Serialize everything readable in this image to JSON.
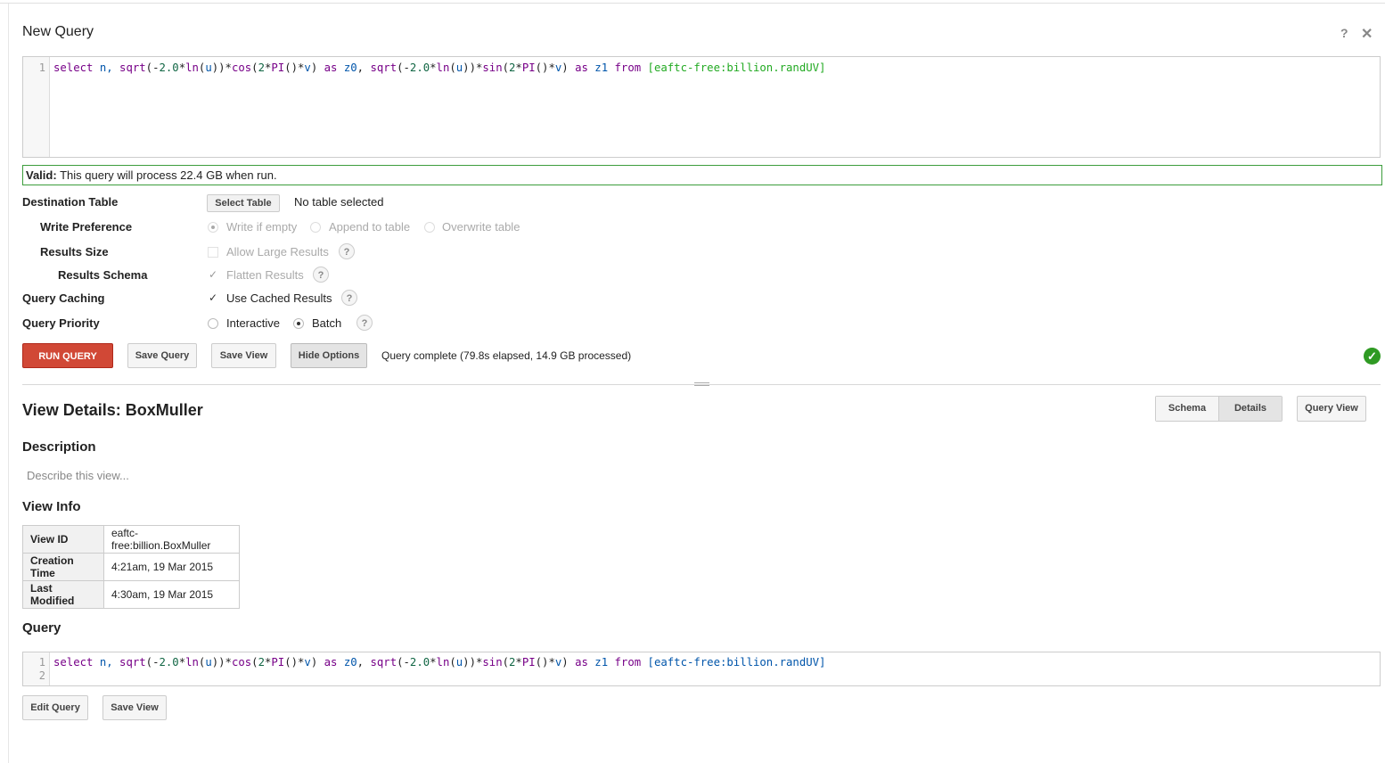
{
  "header": {
    "title": "New Query",
    "help_icon": "?",
    "close_icon": "✕"
  },
  "editor": {
    "line_numbers": [
      "1"
    ],
    "query_parts": {
      "t1": "select",
      "t2": " n, ",
      "t3": "sqrt",
      "t4": "(-",
      "t5": "2.0",
      "t6": "*",
      "t7": "ln",
      "t8": "(",
      "t9": "u",
      "t10": "))*",
      "t11": "cos",
      "t12": "(",
      "t13": "2",
      "t14": "*",
      "t15": "PI",
      "t16": "()*",
      "t17": "v",
      "t18": ") ",
      "t19": "as",
      "t20": " ",
      "t21": "z0",
      "t22": ", ",
      "t23": "sqrt",
      "t24": "(-",
      "t25": "2.0",
      "t26": "*",
      "t27": "ln",
      "t28": "(",
      "t29": "u",
      "t30": "))*",
      "t31": "sin",
      "t32": "(",
      "t33": "2",
      "t34": "*",
      "t35": "PI",
      "t36": "()*",
      "t37": "v",
      "t38": ") ",
      "t39": "as",
      "t40": " ",
      "t41": "z1",
      "t42": " ",
      "t43": "from",
      "t44": " ",
      "t45": "[eaftc-free:billion.randUV]"
    }
  },
  "validation": {
    "prefix": "Valid:",
    "message": "This query will process 22.4 GB when run."
  },
  "options": {
    "destination_table": {
      "label": "Destination Table",
      "button": "Select Table",
      "value": "No table selected"
    },
    "write_preference": {
      "label": "Write Preference",
      "options": [
        "Write if empty",
        "Append to table",
        "Overwrite table"
      ],
      "selected": "Write if empty"
    },
    "results_size": {
      "label": "Results Size",
      "option": "Allow Large Results"
    },
    "results_schema": {
      "label": "Results Schema",
      "option": "Flatten Results"
    },
    "query_caching": {
      "label": "Query Caching",
      "option": "Use Cached Results"
    },
    "query_priority": {
      "label": "Query Priority",
      "options": [
        "Interactive",
        "Batch"
      ],
      "selected": "Batch"
    },
    "help": "?"
  },
  "toolbar": {
    "run": "RUN QUERY",
    "save_query": "Save Query",
    "save_view": "Save View",
    "hide_options": "Hide Options",
    "status": "Query complete (79.8s elapsed, 14.9 GB processed)",
    "status_icon": "✓"
  },
  "details": {
    "title": "View Details: BoxMuller",
    "tabs": [
      "Schema",
      "Details"
    ],
    "active_tab": "Details",
    "query_view_button": "Query View",
    "description_heading": "Description",
    "description_placeholder": "Describe this view...",
    "view_info_heading": "View Info",
    "info_rows": [
      {
        "key": "View ID",
        "value": "eaftc-free:billion.BoxMuller"
      },
      {
        "key": "Creation Time",
        "value": "4:21am, 19 Mar 2015"
      },
      {
        "key": "Last Modified",
        "value": "4:30am, 19 Mar 2015"
      }
    ],
    "query_heading": "Query",
    "query_line_numbers": [
      "1",
      "2"
    ],
    "edit_query_button": "Edit Query",
    "save_view_button": "Save View"
  },
  "colors": {
    "run_button": "#d14836",
    "valid_border": "#3c9d3c",
    "success": "#2f9a23"
  }
}
